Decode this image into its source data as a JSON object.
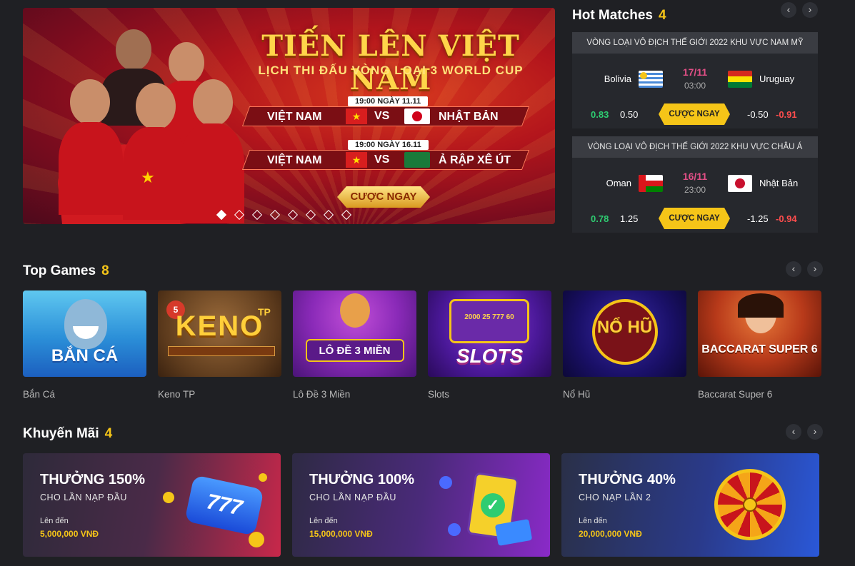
{
  "banner": {
    "title": "TIẾN LÊN VIỆT NAM",
    "subtitle": "LỊCH THI ĐẤU VÒNG LOẠI 3 WORLD CUP",
    "schedules": [
      {
        "time": "19:00 NGÀY 11.11",
        "home": "VIỆT NAM",
        "vs": "VS",
        "away": "NHẬT BẢN"
      },
      {
        "time": "19:00 NGÀY 16.11",
        "home": "VIỆT NAM",
        "vs": "VS",
        "away": "Ả RẬP XÊ ÚT"
      }
    ],
    "cta": "CƯỢC NGAY",
    "slide_count": 8,
    "active_slide": 1
  },
  "hot_matches": {
    "title": "Hot Matches",
    "count": "4",
    "prev_icon": "‹",
    "next_icon": "›",
    "matches": [
      {
        "league": "VÒNG LOẠI VÔ ĐỊCH THẾ GIỚI 2022 KHU VỰC NAM MỸ",
        "home": "Bolivia",
        "home_flag": "uruguay-flag",
        "away": "Uruguay",
        "away_flag": "bolivia-flag",
        "date": "17/11",
        "time": "03:00",
        "home_odds": "0.83",
        "home_handicap": "0.50",
        "bet_label": "CƯỢC NGAY",
        "away_handicap": "-0.50",
        "away_odds": "-0.91"
      },
      {
        "league": "VÒNG LOẠI VÔ ĐỊCH THẾ GIỚI 2022 KHU VỰC CHÂU Á",
        "home": "Oman",
        "home_flag": "oman-flag",
        "away": "Nhật Bản",
        "away_flag": "japan-flag",
        "date": "16/11",
        "time": "23:00",
        "home_odds": "0.78",
        "home_handicap": "1.25",
        "bet_label": "CƯỢC NGAY",
        "away_handicap": "-1.25",
        "away_odds": "-0.94"
      }
    ]
  },
  "top_games": {
    "title": "Top Games",
    "count": "8",
    "prev_icon": "‹",
    "next_icon": "›",
    "items": [
      {
        "name": "Bắn Cá",
        "art_text": "BẮN CÁ"
      },
      {
        "name": "Keno TP",
        "art_text": "KENO",
        "art_sup": "TP"
      },
      {
        "name": "Lô Đề 3 Miền",
        "art_text": "LÔ ĐỀ 3 MIỀN"
      },
      {
        "name": "Slots",
        "art_text": "SLOTS",
        "art_reel": "2000 25 777 60"
      },
      {
        "name": "Nổ Hũ",
        "art_text": "NỔ HŨ"
      },
      {
        "name": "Baccarat Super 6",
        "art_text": "BACCARAT SUPER 6"
      }
    ]
  },
  "promotions": {
    "title": "Khuyến Mãi",
    "count": "4",
    "prev_icon": "‹",
    "next_icon": "›",
    "items": [
      {
        "title": "THƯỞNG 150%",
        "subtitle": "CHO LẦN NẠP ĐẦU",
        "upto_label": "Lên đến",
        "amount": "5,000,000 VNĐ",
        "art_text": "777"
      },
      {
        "title": "THƯỞNG 100%",
        "subtitle": "CHO LẦN NẠP ĐẦU",
        "upto_label": "Lên đến",
        "amount": "15,000,000 VNĐ"
      },
      {
        "title": "THƯỞNG 40%",
        "subtitle": "CHO NẠP LẦN 2",
        "upto_label": "Lên đến",
        "amount": "20,000,000 VNĐ"
      }
    ]
  }
}
